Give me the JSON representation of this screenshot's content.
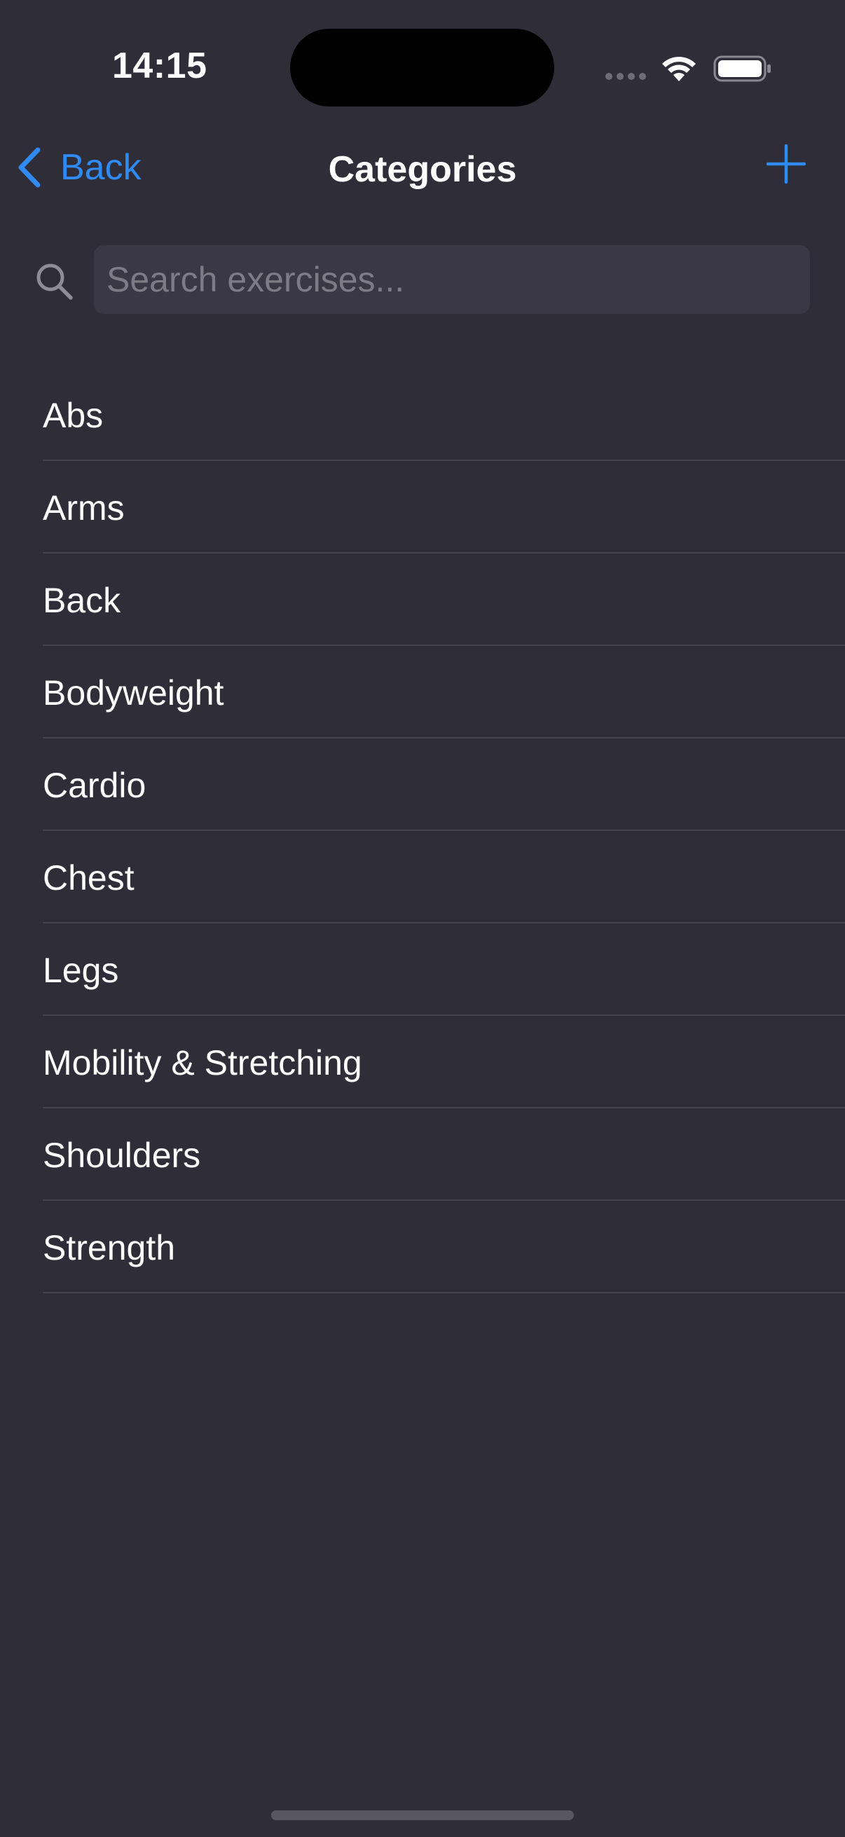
{
  "status_bar": {
    "time": "14:15"
  },
  "nav": {
    "back_label": "Back",
    "title": "Categories",
    "accent_color": "#2f8bf2"
  },
  "search": {
    "placeholder": "Search exercises...",
    "value": ""
  },
  "categories": [
    {
      "label": "Abs"
    },
    {
      "label": "Arms"
    },
    {
      "label": "Back"
    },
    {
      "label": "Bodyweight"
    },
    {
      "label": "Cardio"
    },
    {
      "label": "Chest"
    },
    {
      "label": "Legs"
    },
    {
      "label": "Mobility & Stretching"
    },
    {
      "label": "Shoulders"
    },
    {
      "label": "Strength"
    }
  ],
  "icons": {
    "back": "chevron-left-icon",
    "add": "plus-icon",
    "search": "magnifier-icon",
    "wifi": "wifi-icon",
    "battery": "battery-icon"
  },
  "colors": {
    "background": "#2f2d38",
    "search_field": "#393844",
    "divider": "#45434f",
    "placeholder": "#7d7b86"
  }
}
